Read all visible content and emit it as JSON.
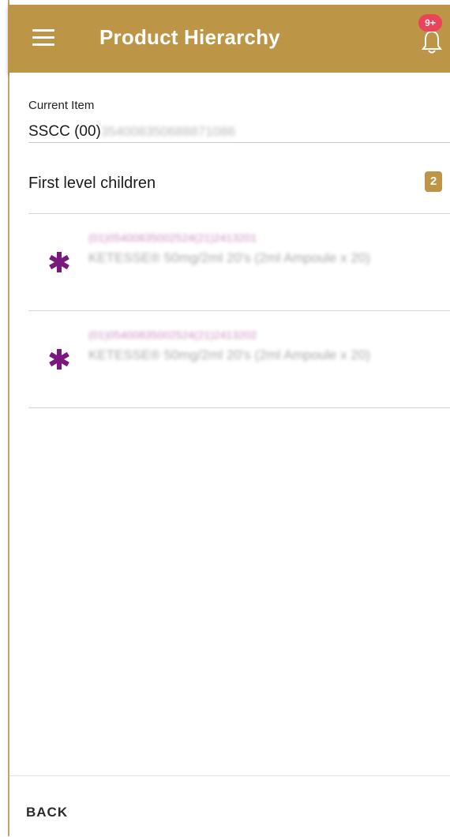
{
  "header": {
    "title": "Product Hierarchy",
    "notification_badge": "9+",
    "accent_color": "#bd9547"
  },
  "current_item": {
    "label": "Current Item",
    "prefix": "SSCC (00)",
    "value": "354008350688871086"
  },
  "children": {
    "heading": "First level children",
    "count": "2",
    "items": [
      {
        "code": "(01)05400835002524(21)2413201",
        "description": "KETESSE® 50mg/2ml 20's (2ml Ampoule x 20)",
        "icon": "asterisk-icon"
      },
      {
        "code": "(01)05400835002524(21)2413202",
        "description": "KETESSE® 50mg/2ml 20's (2ml Ampoule x 20)",
        "icon": "asterisk-icon"
      }
    ]
  },
  "footer": {
    "back_label": "BACK"
  }
}
